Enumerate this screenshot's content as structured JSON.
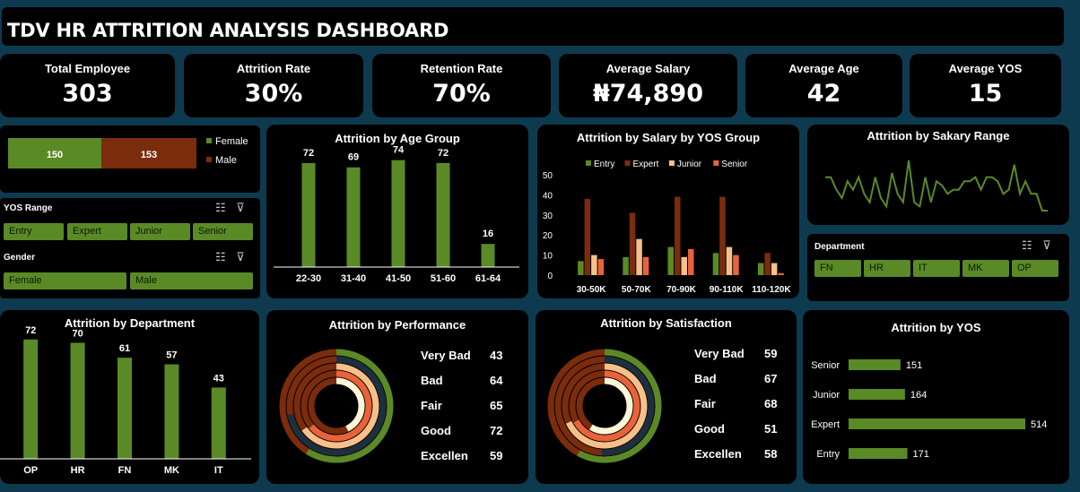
{
  "header": {
    "title": "TDV HR ATTRITION ANALYSIS DASHBOARD"
  },
  "kpis": [
    {
      "label": "Total Employee",
      "value": "303"
    },
    {
      "label": "Attrition Rate",
      "value": "30%"
    },
    {
      "label": "Retention Rate",
      "value": "70%"
    },
    {
      "label": "Average Salary",
      "value": "₦74,890"
    },
    {
      "label": "Average Age",
      "value": "42"
    },
    {
      "label": "Average YOS",
      "value": "15"
    }
  ],
  "colors": {
    "green": "#5a8a26",
    "brown": "#7b2c0c",
    "navy": "#1b2f3f",
    "orange": "#e8623a",
    "peach": "#f7c08a",
    "cream": "#fcf5d8"
  },
  "gender_bar": {
    "female_value": "150",
    "male_value": "153",
    "legend_female": "Female",
    "legend_male": "Male"
  },
  "slicers": {
    "yos": {
      "title": "YOS Range",
      "items": [
        "Entry",
        "Expert",
        "Junior",
        "Senior"
      ]
    },
    "gender": {
      "title": "Gender",
      "items": [
        "Female",
        "Male"
      ]
    },
    "department": {
      "title": "Department",
      "items": [
        "FN",
        "HR",
        "IT",
        "MK",
        "OP"
      ]
    }
  },
  "chart_data": [
    {
      "id": "age",
      "type": "bar",
      "title": "Attrition by Age Group",
      "categories": [
        "22-30",
        "31-40",
        "41-50",
        "51-60",
        "61-64"
      ],
      "values": [
        72,
        69,
        74,
        72,
        16
      ],
      "ylim": [
        0,
        80
      ]
    },
    {
      "id": "salary_yos",
      "type": "bar",
      "title": "Attrition by Salary by YOS Group",
      "categories": [
        "30-50K",
        "50-70K",
        "70-90K",
        "90-110K",
        "110-120K"
      ],
      "series": [
        {
          "name": "Entry",
          "values": [
            7,
            9,
            14,
            11,
            6
          ]
        },
        {
          "name": "Expert",
          "values": [
            38,
            31,
            39,
            39,
            11
          ]
        },
        {
          "name": "Junior",
          "values": [
            10,
            18,
            9,
            14,
            6
          ]
        },
        {
          "name": "Senior",
          "values": [
            8,
            9,
            13,
            10,
            1
          ]
        }
      ],
      "yticks": [
        "0",
        "10",
        "20",
        "30",
        "40",
        "50"
      ],
      "ylim": [
        0,
        50
      ],
      "legend": "top"
    },
    {
      "id": "salary_range",
      "type": "line",
      "title": "Attrition by Sakary Range",
      "values": [
        7,
        7,
        4,
        2,
        6,
        4,
        7,
        3,
        1,
        7,
        2,
        0,
        8,
        3,
        1,
        11,
        1,
        0,
        7,
        1,
        6,
        5,
        3,
        4,
        4,
        6,
        6,
        7,
        4,
        7,
        7,
        6,
        3,
        4,
        10,
        3,
        6,
        3,
        3,
        -1,
        -1
      ]
    },
    {
      "id": "dept",
      "type": "bar",
      "title": "Attrition by Department",
      "categories": [
        "OP",
        "HR",
        "FN",
        "MK",
        "IT"
      ],
      "values": [
        72,
        70,
        61,
        57,
        43
      ],
      "ylim": [
        0,
        80
      ]
    },
    {
      "id": "performance",
      "type": "pie",
      "title": "Attrition by Performance",
      "categories": [
        "Very Bad",
        "Bad",
        "Fair",
        "Good",
        "Excellen"
      ],
      "values": [
        43,
        64,
        65,
        72,
        59
      ]
    },
    {
      "id": "satisfaction",
      "type": "pie",
      "title": "Attrition by Satisfaction",
      "categories": [
        "Very Bad",
        "Bad",
        "Fair",
        "Good",
        "Excellen"
      ],
      "values": [
        59,
        67,
        68,
        51,
        58
      ]
    },
    {
      "id": "yos",
      "type": "bar",
      "title": "Attrition by YOS",
      "categories": [
        "Senior",
        "Junior",
        "Expert",
        "Entry"
      ],
      "values": [
        151,
        164,
        514,
        171
      ],
      "xlim": [
        0,
        600
      ]
    }
  ]
}
